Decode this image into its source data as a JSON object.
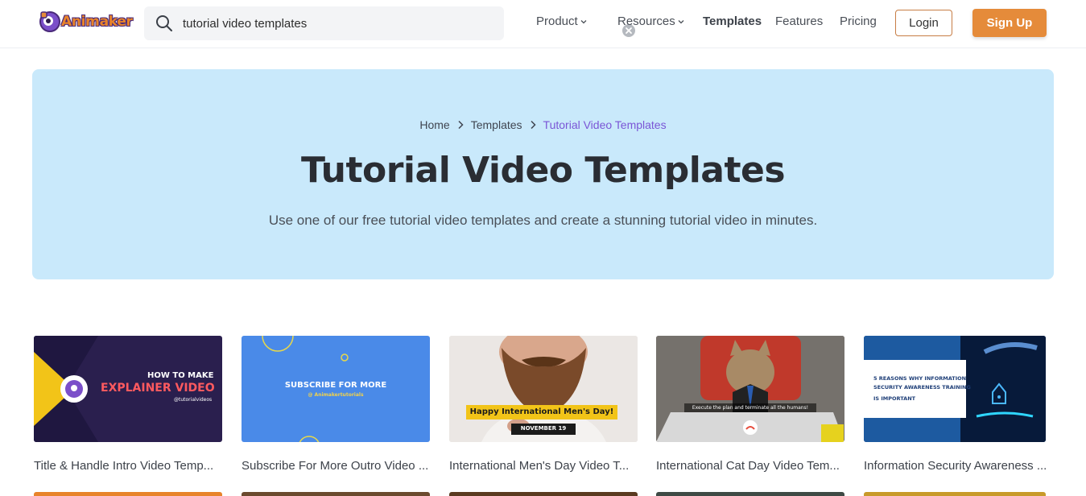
{
  "header": {
    "logo_text": "Animaker",
    "search": {
      "value": "tutorial video templates",
      "placeholder": ""
    },
    "nav": [
      {
        "label": "Product",
        "has_dropdown": true
      },
      {
        "label": "Resources",
        "has_dropdown": true
      },
      {
        "label": "Templates",
        "active": true
      },
      {
        "label": "Features"
      },
      {
        "label": "Pricing"
      }
    ],
    "login_label": "Login",
    "signup_label": "Sign Up"
  },
  "hero": {
    "breadcrumb": [
      "Home",
      "Templates",
      "Tutorial Video Templates"
    ],
    "title": "Tutorial Video Templates",
    "subtitle": "Use one of our free tutorial video templates and create a stunning tutorial video in minutes."
  },
  "templates": [
    {
      "title": "Title & Handle Intro Video Temp...",
      "thumb_lines": [
        "HOW TO MAKE",
        "EXPLAINER VIDEO",
        "@tutorialvideos"
      ]
    },
    {
      "title": "Subscribe For More Outro Video ...",
      "thumb_lines": [
        "SUBSCRIBE FOR MORE",
        "@ Animakertutorials"
      ]
    },
    {
      "title": "International Men's Day Video T...",
      "thumb_lines": [
        "Happy International Men's Day!",
        "NOVEMBER 19"
      ]
    },
    {
      "title": "International Cat Day Video Tem...",
      "thumb_lines": [
        "Execute the plan and terminate all the humans!"
      ]
    },
    {
      "title": "Information Security Awareness ...",
      "thumb_lines": [
        "5 REASONS WHY INFORMATION",
        "SECURITY AWARENESS TRAINING",
        "IS IMPORTANT"
      ]
    }
  ],
  "colors": {
    "accent": "#e58b3a",
    "hero_bg": "#c9e9fb",
    "breadcrumb_current": "#7a55d6"
  }
}
